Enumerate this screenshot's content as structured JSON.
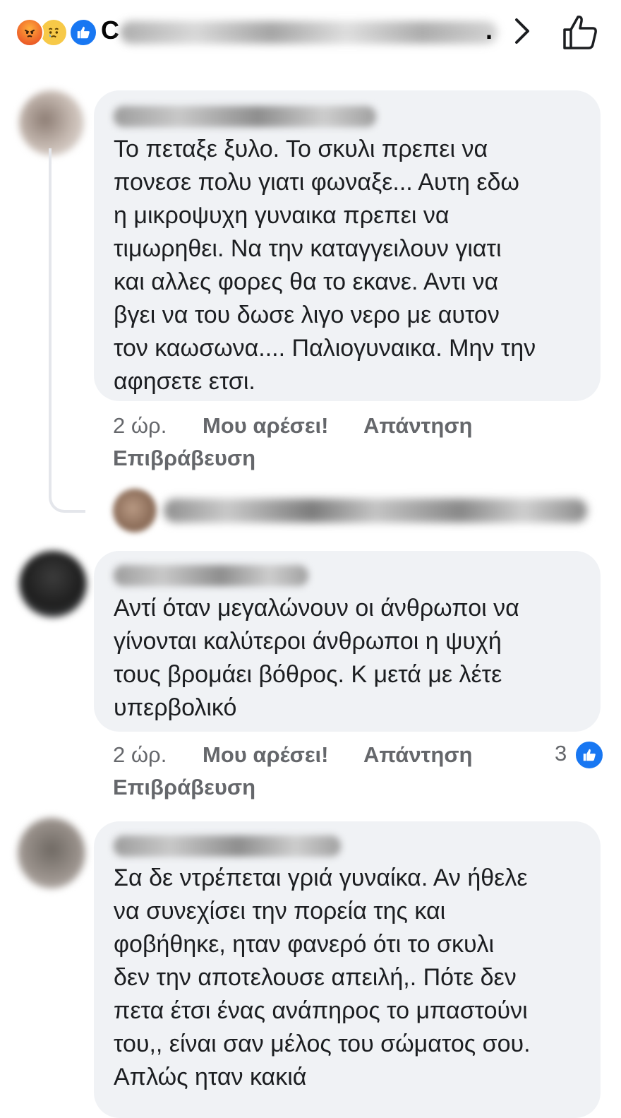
{
  "header": {
    "reactions": [
      "angry-icon",
      "sad-icon",
      "like-icon"
    ],
    "title_initial": "C",
    "title_suffix": ".",
    "accent": "#1877f2"
  },
  "comments": [
    {
      "text": "Το πεταξε ξυλο. Το σκυλι πρεπει να\nπονεσε πολυ γιατι φωναξε... Αυτη εδω\nη μικροψυχη γυναικα πρεπει να\nτιμωρηθει. Να την καταγγειλουν γιατι\nκαι αλλες φορες θα το εκανε. Αντι να\nβγει να του δωσε λιγο νερο με αυτον\nτον καωσωνα.... Παλιογυναικα. Μην την\nαφησετε ετσι.",
      "time": "2 ώρ.",
      "like_label": "Μου αρέσει!",
      "reply_label": "Απάντηση",
      "award_label": "Επιβράβευση"
    },
    {
      "text": "Αντί όταν μεγαλώνουν οι άνθρωποι να\nγίνονται καλύτεροι άνθρωποι η ψυχή\nτους βρομάει βόθρος. Κ μετά με λέτε\nυπερβολικό",
      "time": "2 ώρ.",
      "like_label": "Μου αρέσει!",
      "reply_label": "Απάντηση",
      "award_label": "Επιβράβευση",
      "reaction_count": "3"
    },
    {
      "text": "Σα δε ντρέπεται γριά γυναίκα. Αν ήθελε\nνα  συνεχίσει την πορεία της και\nφοβήθηκε, ηταν φανερό ότι το σκυλι\nδεν την αποτελουσε απειλή,. Πότε δεν\nπετα  έτσι ένας ανάπηρος το μπαστούνι\nτου,, είναι σαν μέλος του σώματος σου.\nΑπλώς ηταν κακιά"
    }
  ]
}
